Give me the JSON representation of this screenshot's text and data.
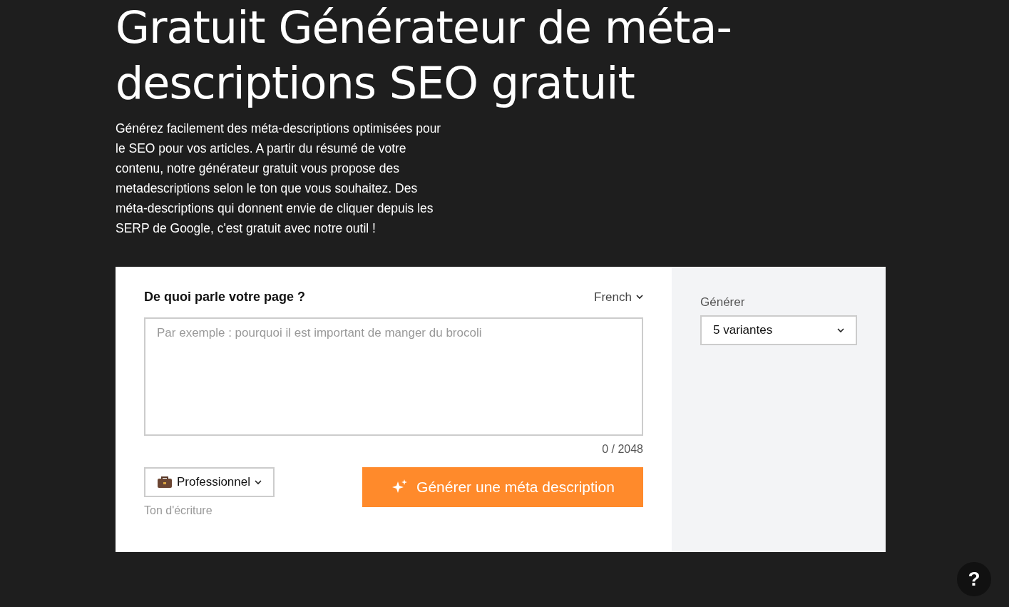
{
  "title": "Gratuit Générateur de méta-descriptions SEO gratuit",
  "intro": "Générez facilement des méta-descriptions optimisées pour le SEO pour vos articles. A partir du résumé de votre contenu, notre générateur gratuit vous propose des metadescriptions selon le ton que vous souhaitez. Des méta-descriptions qui donnent envie de cliquer depuis les SERP de Google, c'est gratuit avec notre outil !",
  "form": {
    "question": "De quoi parle votre page ?",
    "language": "French",
    "placeholder": "Par exemple : pourquoi il est important de manger du brocoli",
    "counter": "0 / 2048",
    "tone": {
      "value": "Professionnel",
      "label": "Ton d'écriture"
    },
    "submit": "Générer une méta description"
  },
  "side": {
    "label": "Générer",
    "value": "5 variantes"
  },
  "help": "?"
}
